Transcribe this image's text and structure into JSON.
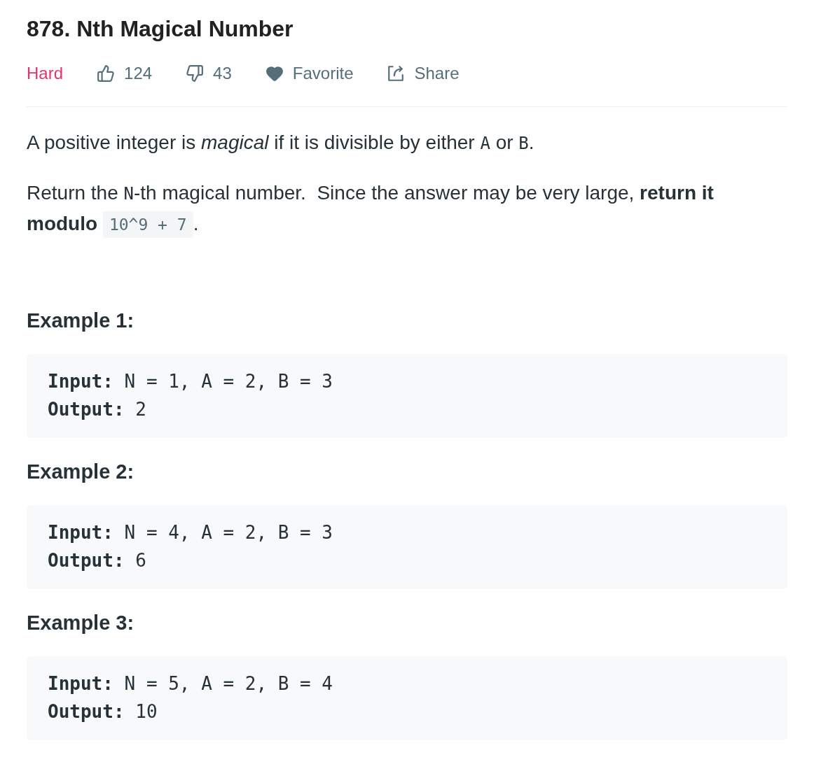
{
  "problem": {
    "title": "878. Nth Magical Number"
  },
  "meta": {
    "difficulty": "Hard",
    "actions": [
      {
        "kind": "like",
        "label": "124"
      },
      {
        "kind": "dislike",
        "label": "43"
      },
      {
        "kind": "favorite",
        "label": "Favorite"
      },
      {
        "kind": "share",
        "label": "Share"
      }
    ]
  },
  "description": [
    [
      {
        "kind": "text",
        "text": "A positive integer is "
      },
      {
        "kind": "italic",
        "text": "magical"
      },
      {
        "kind": "text",
        "text": " if it is divisible by either "
      },
      {
        "kind": "code",
        "text": "A"
      },
      {
        "kind": "text",
        "text": " or "
      },
      {
        "kind": "code",
        "text": "B"
      },
      {
        "kind": "text",
        "text": "."
      }
    ],
    [
      {
        "kind": "text",
        "text": "Return the "
      },
      {
        "kind": "code",
        "text": "N"
      },
      {
        "kind": "text",
        "text": "-th magical number.  Since the answer may be very large, "
      },
      {
        "kind": "bold",
        "text": "return it modulo "
      },
      {
        "kind": "code_box",
        "text": "10^9 + 7"
      },
      {
        "kind": "text",
        "text": "."
      }
    ]
  ],
  "examples": [
    {
      "title": "Example 1:",
      "lines": [
        "**Input:** N = 1, A = 2, B = 3",
        "**Output:** 2"
      ]
    },
    {
      "title": "Example 2:",
      "lines": [
        "**Input:** N = 4, A = 2, B = 3",
        "**Output:** 6"
      ]
    },
    {
      "title": "Example 3:",
      "lines": [
        "**Input:** N = 5, A = 2, B = 4",
        "**Output:** 10"
      ]
    }
  ]
}
